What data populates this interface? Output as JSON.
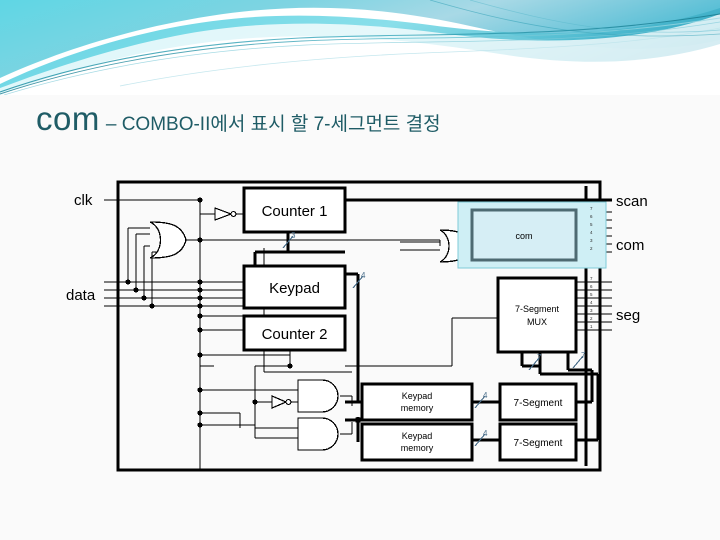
{
  "slide": {
    "background_color": "#FAFAFA",
    "banner": {
      "name": "decorative-wave-banner",
      "colors": [
        "#5FD6E4",
        "#8FDCE8",
        "#2E9FB5",
        "#1F7F92",
        "#FFFFFF"
      ]
    },
    "title": {
      "main": "com",
      "separator_and_subtitle": "– COMBO-II에서 표시 할 7-세그먼트 결정",
      "color": "#1F5C66"
    }
  },
  "diagram": {
    "type": "block-diagram",
    "border_color": "#000000",
    "highlight": {
      "target_block": "com",
      "fill": "#CFEFF5",
      "border": "#7FCBD8",
      "inner_fill": "#D6EEF5",
      "inner_border": "#4E6A72"
    },
    "inputs": [
      {
        "label": "clk",
        "lines": 1
      },
      {
        "label": "data",
        "lines": 4
      }
    ],
    "outputs": [
      {
        "label": "scan",
        "lines": 1
      },
      {
        "label": "com",
        "lines": 6
      },
      {
        "label": "seg",
        "lines": 7
      }
    ],
    "blocks": [
      {
        "id": "counter1",
        "label": "Counter 1",
        "label2": ""
      },
      {
        "id": "keypad",
        "label": "Keypad",
        "label2": ""
      },
      {
        "id": "counter2",
        "label": "Counter 2",
        "label2": ""
      },
      {
        "id": "com",
        "label": "com",
        "label2": ""
      },
      {
        "id": "segmux",
        "label": "7-Segment",
        "label2": "MUX"
      },
      {
        "id": "kpmem1",
        "label": "Keypad",
        "label2": "memory"
      },
      {
        "id": "kpmem2",
        "label": "Keypad",
        "label2": "memory"
      },
      {
        "id": "seg7a",
        "label": "7-Segment",
        "label2": ""
      },
      {
        "id": "seg7b",
        "label": "7-Segment",
        "label2": ""
      }
    ],
    "bus_widths": [
      {
        "id": "counter1-out",
        "value": "3"
      },
      {
        "id": "keypad-out",
        "value": "4"
      },
      {
        "id": "kpmem1-out",
        "value": "4"
      },
      {
        "id": "kpmem2-out",
        "value": "4"
      },
      {
        "id": "segmux-in-a",
        "value": "7"
      },
      {
        "id": "segmux-in-b",
        "value": "7"
      }
    ],
    "gates": [
      {
        "id": "or-data",
        "type": "or",
        "inputs": 4
      },
      {
        "id": "or-com",
        "type": "or",
        "inputs": 2
      },
      {
        "id": "and-top",
        "type": "and",
        "inputs": 2
      },
      {
        "id": "and-bot",
        "type": "and",
        "inputs": 2
      },
      {
        "id": "inv-clk",
        "type": "inverter",
        "inputs": 1
      },
      {
        "id": "inv-and",
        "type": "inverter",
        "inputs": 1
      }
    ]
  }
}
